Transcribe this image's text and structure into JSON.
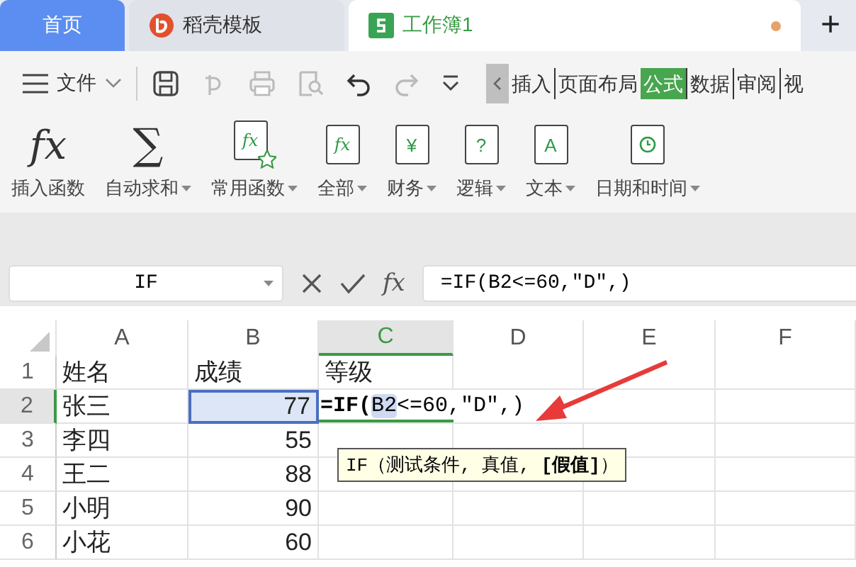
{
  "tabs": [
    {
      "label": "首页",
      "kind": "home",
      "selected": false,
      "unsaved": false
    },
    {
      "label": "稻壳模板",
      "kind": "docer",
      "selected": false,
      "unsaved": false
    },
    {
      "label": "工作簿1",
      "kind": "sheet",
      "selected": true,
      "unsaved": true
    }
  ],
  "new_tab": "+",
  "menu": {
    "label": "文件"
  },
  "ribbon_tabs": [
    {
      "label": "插入",
      "selected": false
    },
    {
      "label": "页面布局",
      "selected": false
    },
    {
      "label": "公式",
      "selected": true
    },
    {
      "label": "数据",
      "selected": false
    },
    {
      "label": "审阅",
      "selected": false
    },
    {
      "label": "视",
      "selected": false
    }
  ],
  "ribbon": [
    {
      "label": "插入函数",
      "kind": "fx",
      "glyph": "fx",
      "dropdown": false
    },
    {
      "label": "自动求和",
      "kind": "sum",
      "glyph": "∑",
      "dropdown": true
    },
    {
      "label": "常用函数",
      "kind": "star-book",
      "glyph": "fx",
      "dropdown": true
    },
    {
      "label": "全部",
      "kind": "book",
      "glyph": "fx",
      "dropdown": true
    },
    {
      "label": "财务",
      "kind": "book",
      "glyph": "¥",
      "dropdown": true
    },
    {
      "label": "逻辑",
      "kind": "book",
      "glyph": "?",
      "dropdown": true
    },
    {
      "label": "文本",
      "kind": "book",
      "glyph": "A",
      "dropdown": true
    },
    {
      "label": "日期和时间",
      "kind": "clock-book",
      "dropdown": true
    }
  ],
  "formula_bar": {
    "name_box": "IF",
    "fx_label": "fx",
    "formula": "=IF(B2<=60,\"D\",)"
  },
  "columns": [
    {
      "label": "A",
      "selected": false
    },
    {
      "label": "B",
      "selected": false
    },
    {
      "label": "C",
      "selected": true
    },
    {
      "label": "D",
      "selected": false
    },
    {
      "label": "E",
      "selected": false
    },
    {
      "label": "F",
      "selected": false
    }
  ],
  "rows": [
    {
      "number": "1",
      "selected": false,
      "cells": [
        {
          "text": "姓名",
          "referenced": false
        },
        {
          "text": "成绩",
          "referenced": false
        },
        {
          "text": "等级",
          "referenced": false
        }
      ]
    },
    {
      "number": "2",
      "selected": true,
      "cells": [
        {
          "text": "张三",
          "referenced": false
        },
        {
          "text": "77",
          "referenced": true
        }
      ],
      "editor": {
        "start": "=IF(",
        "ref": "B2",
        "rest": "<=60,\"D\",)",
        "tooltip": "IF（测试条件, 真值, **[假值]**）"
      }
    },
    {
      "number": "3",
      "selected": false,
      "cells": [
        {
          "text": "李四",
          "referenced": false
        },
        {
          "text": "55",
          "referenced": false
        }
      ]
    },
    {
      "number": "4",
      "selected": false,
      "cells": [
        {
          "text": "王二",
          "referenced": false
        },
        {
          "text": "88",
          "referenced": false
        }
      ]
    },
    {
      "number": "5",
      "selected": false,
      "cells": [
        {
          "text": "小明",
          "referenced": false
        },
        {
          "text": "90",
          "referenced": false
        }
      ]
    },
    {
      "number": "6",
      "selected": false,
      "cells": [
        {
          "text": "小花",
          "referenced": false
        },
        {
          "text": "60",
          "referenced": false
        }
      ]
    }
  ]
}
